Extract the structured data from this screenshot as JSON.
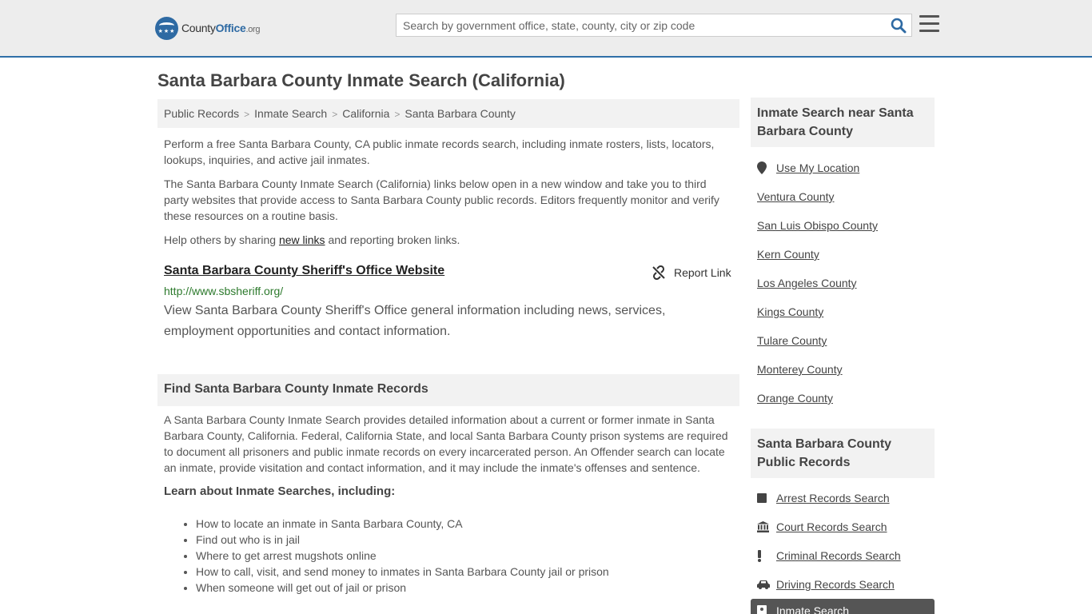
{
  "header": {
    "logo_word_county": "County",
    "logo_word_office": "Office",
    "logo_tld": ".org",
    "search_placeholder": "Search by government office, state, county, city or zip code"
  },
  "page_title": "Santa Barbara County Inmate Search (California)",
  "breadcrumb": [
    "Public Records",
    "Inmate Search",
    "California",
    "Santa Barbara County"
  ],
  "intro": {
    "p1": "Perform a free Santa Barbara County, CA public inmate records search, including inmate rosters, lists, locators, lookups, inquiries, and active jail inmates.",
    "p2": "The Santa Barbara County Inmate Search (California) links below open in a new window and take you to third party websites that provide access to Santa Barbara County public records. Editors frequently monitor and verify these resources on a routine basis.",
    "p3_before": "Help others by sharing ",
    "p3_link": "new links",
    "p3_after": " and reporting broken links."
  },
  "result": {
    "title": "Santa Barbara County Sheriff's Office Website",
    "report_label": "Report Link",
    "url": "http://www.sbsheriff.org/",
    "description": "View Santa Barbara County Sheriff's Office general information including news, services, employment opportunities and contact information."
  },
  "find_section": {
    "heading": "Find Santa Barbara County Inmate Records",
    "body": "A Santa Barbara County Inmate Search provides detailed information about a current or former inmate in Santa Barbara County, California. Federal, California State, and local Santa Barbara County prison systems are required to document all prisoners and public inmate records on every incarcerated person. An Offender search can locate an inmate, provide visitation and contact information, and it may include the inmate's offenses and sentence.",
    "learn_heading": "Learn about Inmate Searches, including:",
    "bullets": [
      "How to locate an inmate in Santa Barbara County, CA",
      "Find out who is in jail",
      "Where to get arrest mugshots online",
      "How to call, visit, and send money to inmates in Santa Barbara County jail or prison",
      "When someone will get out of jail or prison"
    ]
  },
  "sidebar": {
    "nearby_heading": "Inmate Search near Santa Barbara County",
    "use_location": "Use My Location",
    "nearby": [
      "Ventura County",
      "San Luis Obispo County",
      "Kern County",
      "Los Angeles County",
      "Kings County",
      "Tulare County",
      "Monterey County",
      "Orange County"
    ],
    "records_heading": "Santa Barbara County Public Records",
    "records": [
      {
        "label": "Arrest Records Search",
        "icon": "square-icon"
      },
      {
        "label": "Court Records Search",
        "icon": "courthouse-icon"
      },
      {
        "label": "Criminal Records Search",
        "icon": "exclamation-icon"
      },
      {
        "label": "Driving Records Search",
        "icon": "car-icon"
      }
    ],
    "active_record": "Inmate Search"
  }
}
